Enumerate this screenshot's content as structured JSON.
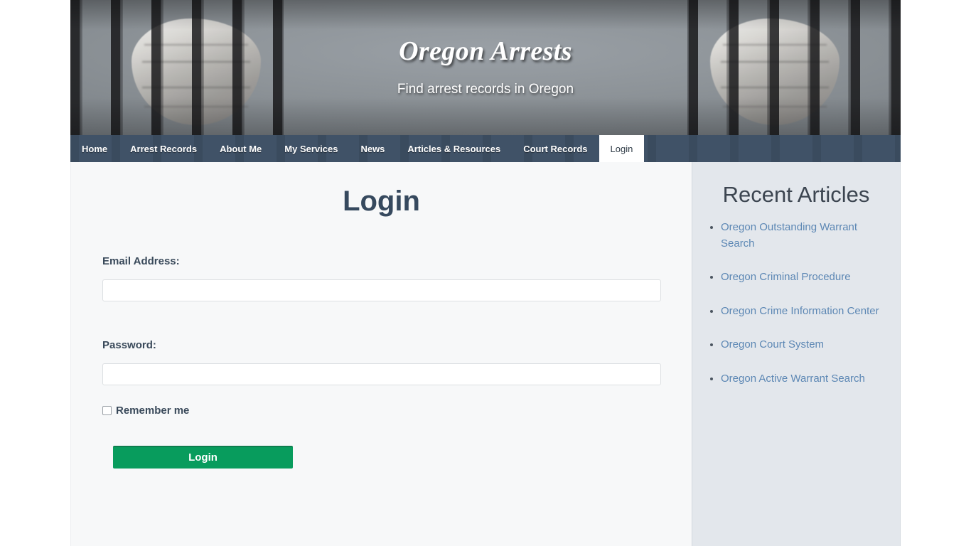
{
  "site": {
    "title": "Oregon Arrests",
    "tagline": "Find arrest records in Oregon"
  },
  "nav": {
    "items": [
      {
        "label": "Home",
        "active": false
      },
      {
        "label": "Arrest Records",
        "active": false
      },
      {
        "label": "About Me",
        "active": false
      },
      {
        "label": "My Services",
        "active": false
      },
      {
        "label": "News",
        "active": false
      },
      {
        "label": "Articles & Resources",
        "active": false
      },
      {
        "label": "Court Records",
        "active": false
      },
      {
        "label": "Login",
        "active": true
      }
    ]
  },
  "main": {
    "heading": "Login",
    "email_label": "Email Address:",
    "email_value": "",
    "email_placeholder": "",
    "password_label": "Password:",
    "password_value": "",
    "password_placeholder": "",
    "remember_label": "Remember me",
    "remember_checked": false,
    "submit_label": "Login"
  },
  "sidebar": {
    "heading": "Recent Articles",
    "articles": [
      {
        "label": "Oregon Outstanding Warrant Search"
      },
      {
        "label": "Oregon Criminal Procedure"
      },
      {
        "label": "Oregon Crime Information Center"
      },
      {
        "label": "Oregon Court System"
      },
      {
        "label": "Oregon Active Warrant Search"
      }
    ]
  },
  "colors": {
    "nav_background": "#263a52",
    "heading": "#36495e",
    "button_green": "#089c5d",
    "link_blue": "#5c87b4",
    "sidebar_background": "#e3e7ec",
    "main_background": "#f7f8f9"
  }
}
